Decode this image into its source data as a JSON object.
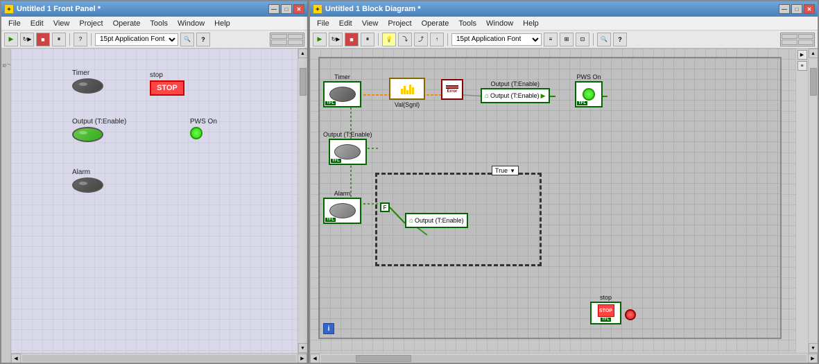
{
  "front_panel": {
    "title": "Untitled 1 Front Panel *",
    "menu": [
      "File",
      "Edit",
      "View",
      "Project",
      "Operate",
      "Tools",
      "Window",
      "Help"
    ],
    "font": "15pt Application Font",
    "controls": {
      "timer": {
        "label": "Timer",
        "active": false
      },
      "stop": {
        "label": "stop",
        "btn_label": "STOP"
      },
      "output_enable": {
        "label": "Output (T:Enable)",
        "active": true
      },
      "pws_on": {
        "label": "PWS On"
      },
      "alarm": {
        "label": "Alarm",
        "active": false
      }
    }
  },
  "block_diagram": {
    "title": "Untitled 1 Block Diagram *",
    "menu": [
      "File",
      "Edit",
      "View",
      "Project",
      "Operate",
      "Tools",
      "Window",
      "Help"
    ],
    "font": "15pt Application Font",
    "nodes": {
      "timer": {
        "label": "Timer",
        "tfl": "TFL"
      },
      "output_enable_top": {
        "label": "Output (T:Enable)",
        "tfl": "TFL"
      },
      "val_sgni": {
        "label": "Val(Sgnl)"
      },
      "error": {
        "label": "Error"
      },
      "pws_output": {
        "label": "⌂Output (T:Enable)"
      },
      "pws_on": {
        "label": "PWS On",
        "tfl": "TFL"
      },
      "output_enable_mid": {
        "label": "Output (T:Enable)",
        "tfl": "TFL"
      },
      "alarm": {
        "label": "Alarm",
        "tfl": "TFL"
      },
      "case_true": {
        "label": "True"
      },
      "case_output": {
        "label": "⌂Output (T:Enable)"
      },
      "stop_node": {
        "label": "stop",
        "tfl": "TFL"
      }
    },
    "info_icon": "i"
  }
}
